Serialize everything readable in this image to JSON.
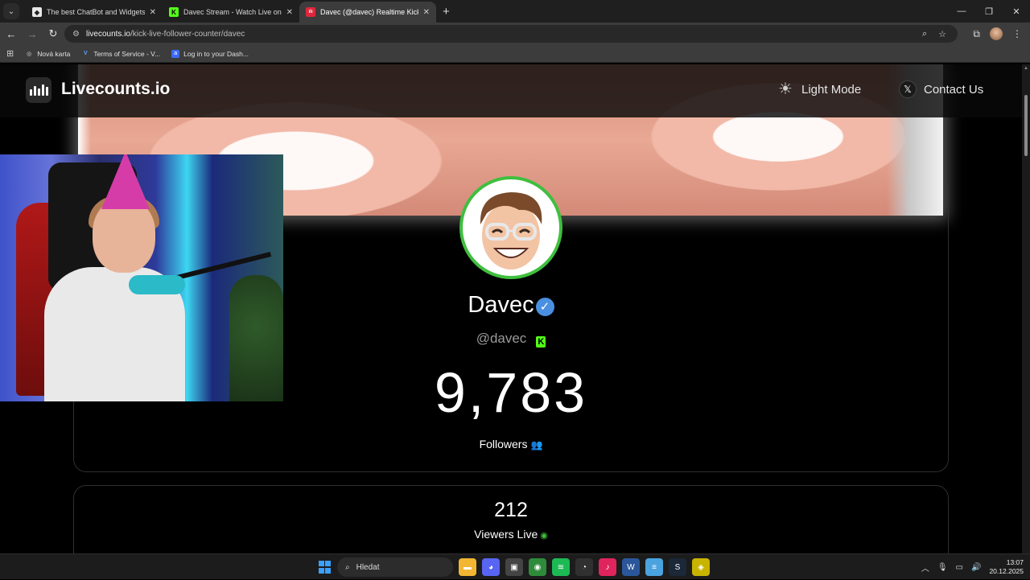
{
  "browser": {
    "tabs": [
      {
        "title": "The best ChatBot and Widgets",
        "favicon_color": "#e8e8e8",
        "favicon_glyph": "◆",
        "active": false
      },
      {
        "title": "Davec Stream - Watch Live on",
        "favicon_color": "#53fc18",
        "favicon_glyph": "K",
        "active": false
      },
      {
        "title": "Davec (@davec) Realtime Kick",
        "favicon_color": "#e0263c",
        "favicon_glyph": "ılı",
        "active": true
      }
    ],
    "new_tab": "+",
    "window_controls": {
      "minimize": "—",
      "maximize": "❐",
      "close": "✕"
    },
    "url": {
      "host": "livecounts.io",
      "path": "/kick-live-follower-counter/davec"
    },
    "bookmarks": [
      {
        "label": "Nová karta",
        "icon_color": "#cfcfcf",
        "glyph": "◎"
      },
      {
        "label": "Terms of Service - V...",
        "icon_color": "#5aa0ff",
        "glyph": "V"
      },
      {
        "label": "Log in to your Dash...",
        "icon_color": "#3b6bff",
        "glyph": "a"
      }
    ]
  },
  "site": {
    "brand": "Livecounts.io",
    "nav": {
      "light_mode": "Light Mode",
      "contact": "Contact Us"
    }
  },
  "profile": {
    "name": "Davec",
    "verified": "✓",
    "handle": "@davec",
    "platform_badge": "K",
    "followers": "9,783",
    "followers_label": "Followers",
    "viewers": "212",
    "viewers_label": "Viewers Live"
  },
  "icons": {
    "users": "👥",
    "eye": "◉",
    "sun": "☀",
    "x": "𝕏"
  },
  "taskbar": {
    "search_label": "Hledat",
    "apps": [
      {
        "name": "file-explorer",
        "color": "#f2b632",
        "glyph": "▬"
      },
      {
        "name": "discord",
        "color": "#5865f2",
        "glyph": "◕"
      },
      {
        "name": "snipping",
        "color": "#444444",
        "glyph": "▣"
      },
      {
        "name": "chrome",
        "color": "#2e8b3a",
        "glyph": "◉"
      },
      {
        "name": "spotify",
        "color": "#1db954",
        "glyph": "≋"
      },
      {
        "name": "obs",
        "color": "#303030",
        "glyph": "◔"
      },
      {
        "name": "tiktok",
        "color": "#e0245e",
        "glyph": "♪"
      },
      {
        "name": "word",
        "color": "#2b579a",
        "glyph": "W"
      },
      {
        "name": "notepad",
        "color": "#4aa3df",
        "glyph": "≡"
      },
      {
        "name": "steam",
        "color": "#1b2838",
        "glyph": "S"
      },
      {
        "name": "app",
        "color": "#c8b400",
        "glyph": "◈"
      }
    ],
    "time": "13:07",
    "date": "20.12.2025"
  }
}
